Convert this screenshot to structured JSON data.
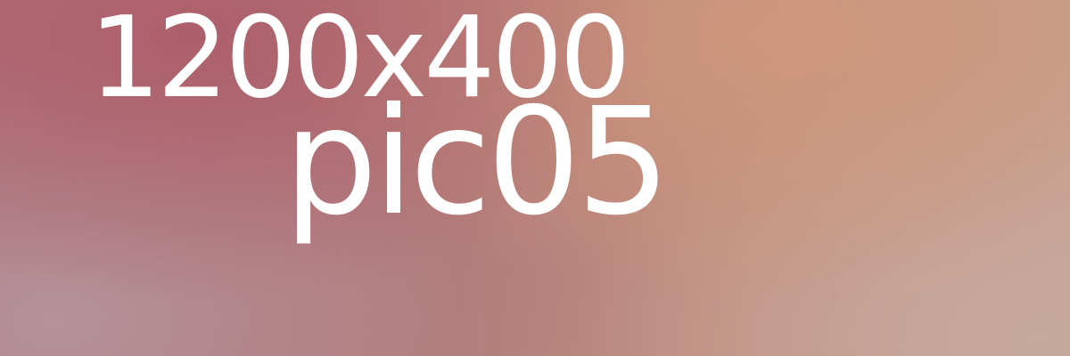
{
  "image": {
    "dimensions_text": "1200x400",
    "name_text": "pic05",
    "text_color": "#ffffff",
    "background_colors": [
      "#ac5c68",
      "#d0987c",
      "#b4969e",
      "#c6aa9e"
    ]
  }
}
